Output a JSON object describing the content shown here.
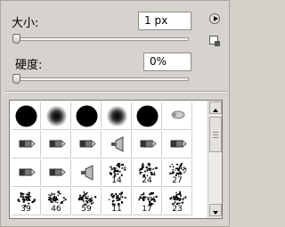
{
  "size": {
    "label": "大小:",
    "value": "1 px",
    "slider_level": 0
  },
  "hardness": {
    "label": "硬度:",
    "value": "0%",
    "slider_level": 0
  },
  "icons": {
    "panel_menu": "triangle-right-icon",
    "new_preset": "new-preset-icon"
  },
  "brushes": [
    {
      "kind": "hard-round",
      "num": ""
    },
    {
      "kind": "soft-round",
      "num": ""
    },
    {
      "kind": "hard-round",
      "num": ""
    },
    {
      "kind": "soft-round",
      "num": ""
    },
    {
      "kind": "hard-round",
      "num": ""
    },
    {
      "kind": "airbrush",
      "num": ""
    },
    {
      "kind": "tool",
      "num": ""
    },
    {
      "kind": "tool",
      "num": ""
    },
    {
      "kind": "tool",
      "num": ""
    },
    {
      "kind": "tool-cone",
      "num": ""
    },
    {
      "kind": "tool",
      "num": ""
    },
    {
      "kind": "tool",
      "num": ""
    },
    {
      "kind": "tool",
      "num": ""
    },
    {
      "kind": "tool",
      "num": ""
    },
    {
      "kind": "tool-cone",
      "num": ""
    },
    {
      "kind": "scatter",
      "num": "14"
    },
    {
      "kind": "scatter",
      "num": "24"
    },
    {
      "kind": "scatter",
      "num": "27"
    },
    {
      "kind": "scatter",
      "num": "39"
    },
    {
      "kind": "scatter",
      "num": "46"
    },
    {
      "kind": "scatter",
      "num": "59"
    },
    {
      "kind": "scatter",
      "num": "11"
    },
    {
      "kind": "scatter",
      "num": "17"
    },
    {
      "kind": "scatter",
      "num": "23"
    }
  ]
}
